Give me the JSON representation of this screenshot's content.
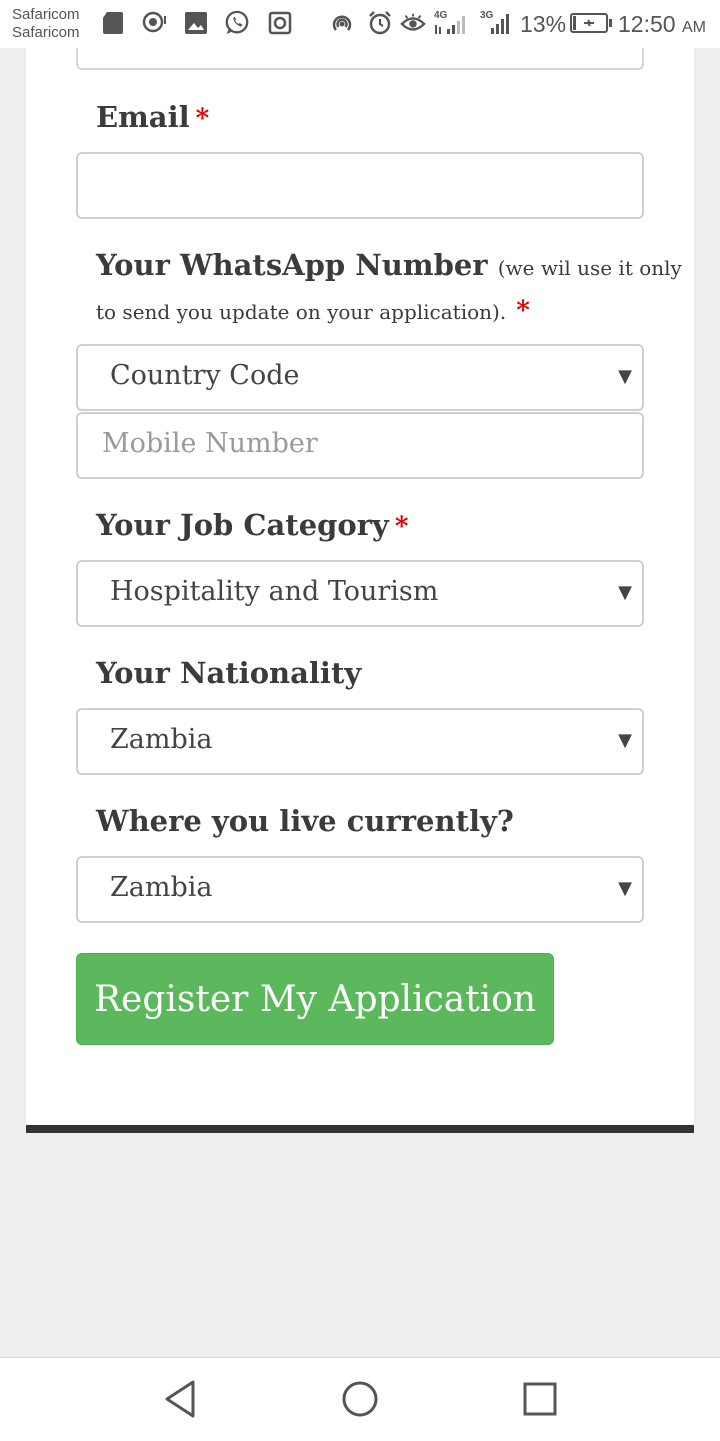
{
  "status_bar": {
    "carrier_1": "Safaricom",
    "carrier_2": "Safaricom",
    "network_1": "4G",
    "network_2": "3G",
    "battery": "13%",
    "time": "12:50",
    "ampm": "AM",
    "icons": [
      "sd-card-icon",
      "location-icon",
      "gallery-icon",
      "whatsapp-icon",
      "screen-record-icon",
      "hotspot-icon",
      "alarm-icon",
      "eye-comfort-icon",
      "signal-icon",
      "signal-icon",
      "battery-charging-icon"
    ]
  },
  "form": {
    "email_label": "Email",
    "required_mark": "*",
    "whatsapp_label": "Your WhatsApp Number",
    "whatsapp_hint_1": "(we wil use it only",
    "whatsapp_hint_2": "to send you update on your application).",
    "country_code_value": "Country Code",
    "mobile_placeholder": "Mobile Number",
    "job_category_label": "Your Job Category",
    "job_category_value": "Hospitality and Tourism",
    "nationality_label": "Your Nationality",
    "nationality_value": "Zambia",
    "residence_label": "Where you live currently?",
    "residence_value": "Zambia",
    "submit_label": "Register My Application",
    "caret": "▼"
  },
  "colors": {
    "submit_bg": "#5cb85c",
    "required": "#e00000",
    "page_bg": "#eeeeee"
  },
  "nav_bar": {
    "buttons": [
      "back-icon",
      "home-icon",
      "recents-icon"
    ]
  }
}
